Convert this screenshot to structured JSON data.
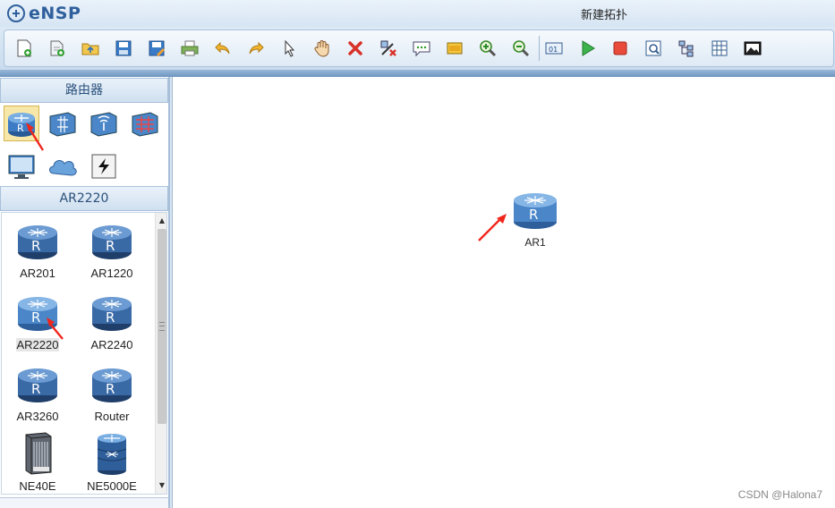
{
  "app": {
    "name": "eNSP",
    "window_title": "新建拓扑"
  },
  "toolbar": {
    "buttons": [
      "new-topology",
      "new-lab",
      "open",
      "save",
      "save-as",
      "print",
      "undo",
      "redo",
      "select",
      "pan",
      "delete",
      "delete-link",
      "text-note",
      "palette",
      "zoom-in",
      "zoom-out",
      "show-interfaces",
      "start-device",
      "stop-device",
      "capture",
      "topology-view",
      "grid",
      "screenshot"
    ]
  },
  "left_panel": {
    "category_title": "路由器",
    "categories": [
      {
        "name": "router",
        "selected": true
      },
      {
        "name": "switch"
      },
      {
        "name": "wireless"
      },
      {
        "name": "firewall"
      },
      {
        "name": "pc"
      },
      {
        "name": "cloud"
      },
      {
        "name": "link"
      }
    ],
    "model_title": "AR2220",
    "models": [
      {
        "label": "AR201",
        "type": "router"
      },
      {
        "label": "AR1220",
        "type": "router"
      },
      {
        "label": "AR2220",
        "type": "router",
        "selected": true
      },
      {
        "label": "AR2240",
        "type": "router"
      },
      {
        "label": "AR3260",
        "type": "router"
      },
      {
        "label": "Router",
        "type": "router"
      },
      {
        "label": "NE40E",
        "type": "chassis"
      },
      {
        "label": "NE5000E",
        "type": "ne-router"
      }
    ]
  },
  "canvas": {
    "devices": [
      {
        "label": "AR1"
      }
    ],
    "watermark": "CSDN @Halona7"
  },
  "colors": {
    "router_body": "#3d7bc4",
    "arrow": "#f0261c"
  }
}
